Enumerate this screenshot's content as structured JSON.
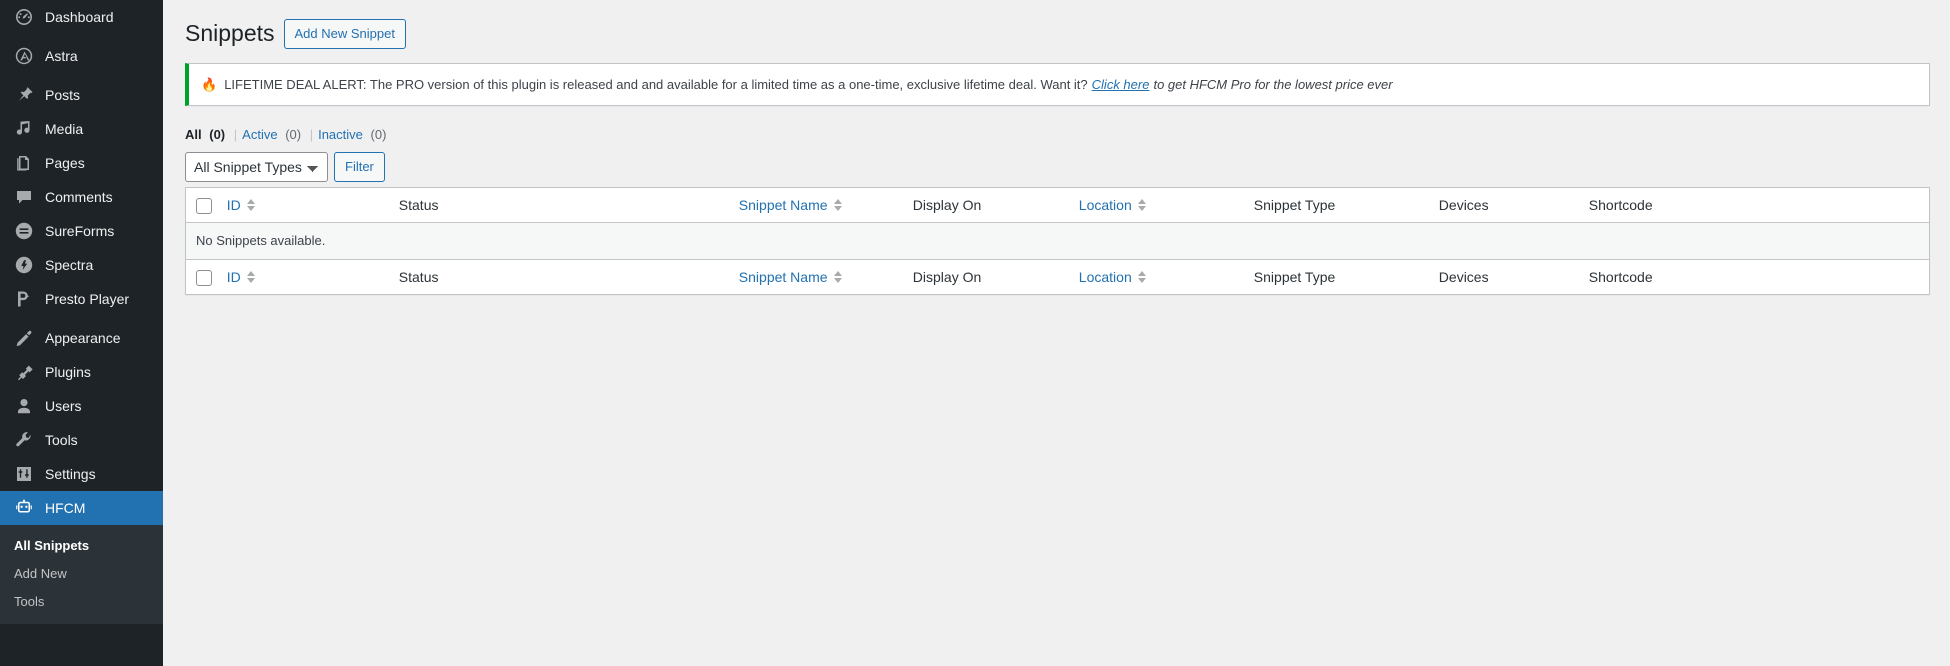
{
  "sidebar": {
    "items": [
      {
        "label": "Dashboard",
        "icon": "dashboard-icon",
        "name": "sidebar-item-dashboard",
        "separator_after": true
      },
      {
        "label": "Astra",
        "icon": "astra-icon",
        "name": "sidebar-item-astra",
        "separator_after": true
      },
      {
        "label": "Posts",
        "icon": "pin-icon",
        "name": "sidebar-item-posts",
        "separator_after": false
      },
      {
        "label": "Media",
        "icon": "media-icon",
        "name": "sidebar-item-media",
        "separator_after": false
      },
      {
        "label": "Pages",
        "icon": "pages-icon",
        "name": "sidebar-item-pages",
        "separator_after": false
      },
      {
        "label": "Comments",
        "icon": "comments-icon",
        "name": "sidebar-item-comments",
        "separator_after": false
      },
      {
        "label": "SureForms",
        "icon": "sureforms-icon",
        "name": "sidebar-item-sureforms",
        "separator_after": false
      },
      {
        "label": "Spectra",
        "icon": "spectra-icon",
        "name": "sidebar-item-spectra",
        "separator_after": false
      },
      {
        "label": "Presto Player",
        "icon": "presto-player-icon",
        "name": "sidebar-item-presto-player",
        "separator_after": true
      },
      {
        "label": "Appearance",
        "icon": "paintbrush-icon",
        "name": "sidebar-item-appearance",
        "separator_after": false
      },
      {
        "label": "Plugins",
        "icon": "plugins-icon",
        "name": "sidebar-item-plugins",
        "separator_after": false
      },
      {
        "label": "Users",
        "icon": "user-icon",
        "name": "sidebar-item-users",
        "separator_after": false
      },
      {
        "label": "Tools",
        "icon": "wrench-icon",
        "name": "sidebar-item-tools",
        "separator_after": false
      },
      {
        "label": "Settings",
        "icon": "settings-sliders-icon",
        "name": "sidebar-item-settings",
        "separator_after": true
      },
      {
        "label": "HFCM",
        "icon": "robot-icon",
        "name": "sidebar-item-hfcm",
        "current": true,
        "separator_after": false
      }
    ],
    "submenu": [
      {
        "label": "All Snippets",
        "name": "submenu-item-all-snippets",
        "current": true
      },
      {
        "label": "Add New",
        "name": "submenu-item-add-new",
        "current": false
      },
      {
        "label": "Tools",
        "name": "submenu-item-tools",
        "current": false
      }
    ],
    "active_color": "#2271b1",
    "background_color": "#1d2327",
    "submenu_background_color": "#2c3338"
  },
  "header": {
    "title": "Snippets",
    "add_new_label": "Add New Snippet"
  },
  "notice": {
    "icon": "fire-icon",
    "icon_glyph": "🔥",
    "text": "LIFETIME DEAL ALERT: The PRO version of this plugin is released and and available for a limited time as a one-time, exclusive lifetime deal. Want it?",
    "link_text": "Click here",
    "tail_text": "to get HFCM Pro for the lowest price ever",
    "accent_color": "#00a32a"
  },
  "filters": {
    "links": [
      {
        "label": "All",
        "count": "(0)",
        "current": true,
        "name": "filter-link-all"
      },
      {
        "label": "Active",
        "count": "(0)",
        "current": false,
        "name": "filter-link-active"
      },
      {
        "label": "Inactive",
        "count": "(0)",
        "current": false,
        "name": "filter-link-inactive"
      }
    ],
    "separator": "|"
  },
  "tablenav": {
    "snippet_type_selected": "All Snippet Types",
    "snippet_type_options": [
      "All Snippet Types"
    ],
    "filter_button_label": "Filter"
  },
  "table": {
    "columns": [
      {
        "label": "ID",
        "sortable": true,
        "name": "column-id"
      },
      {
        "label": "Status",
        "sortable": false,
        "name": "column-status"
      },
      {
        "label": "Snippet Name",
        "sortable": true,
        "name": "column-snippet-name"
      },
      {
        "label": "Display On",
        "sortable": false,
        "name": "column-display-on"
      },
      {
        "label": "Location",
        "sortable": true,
        "name": "column-location"
      },
      {
        "label": "Snippet Type",
        "sortable": false,
        "name": "column-snippet-type"
      },
      {
        "label": "Devices",
        "sortable": false,
        "name": "column-devices"
      },
      {
        "label": "Shortcode",
        "sortable": false,
        "name": "column-shortcode"
      }
    ],
    "rows": [],
    "empty_message": "No Snippets available."
  }
}
